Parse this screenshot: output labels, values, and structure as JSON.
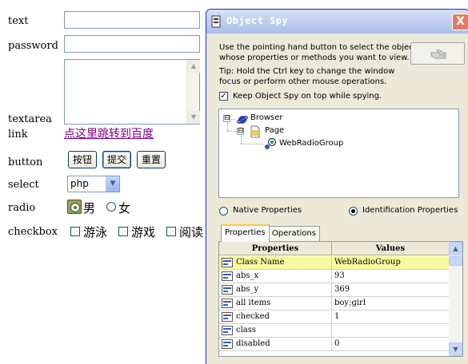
{
  "form": {
    "labels": {
      "text": "text",
      "password": "password",
      "textarea": "textarea",
      "link": "link",
      "button": "button",
      "select": "select",
      "radio": "radio",
      "checkbox": "checkbox"
    },
    "link_text": "点这里跳转到百度",
    "buttons": [
      "按钮",
      "提交",
      "重置"
    ],
    "select_value": "php",
    "radios": [
      {
        "label": "男",
        "checked": true
      },
      {
        "label": "女",
        "checked": false
      }
    ],
    "checkboxes": [
      {
        "label": "游泳",
        "checked": false
      },
      {
        "label": "游戏",
        "checked": false
      },
      {
        "label": "阅读",
        "checked": false
      }
    ]
  },
  "spy": {
    "title": "Object Spy",
    "close_glyph": "X",
    "description": [
      "Use the pointing hand button to select the object",
      "whose properties or methods you want to view."
    ],
    "tip": [
      "Tip: Hold the Ctrl key to change the window",
      "focus or perform other mouse operations."
    ],
    "keep_on_top": {
      "label": "Keep Object Spy on top while spying.",
      "checked": true
    },
    "tree": [
      {
        "label": "Browser",
        "icon": "browser-icon",
        "expander": "⊟"
      },
      {
        "label": "Page",
        "icon": "page-icon",
        "expander": "⊟"
      },
      {
        "label": "WebRadioGroup",
        "icon": "radio-group-icon"
      }
    ],
    "view_options": [
      {
        "label": "Native Properties",
        "selected": false
      },
      {
        "label": "Identification Properties",
        "selected": true
      }
    ],
    "tabs": [
      {
        "label": "Properties",
        "active": true
      },
      {
        "label": "Operations",
        "active": false
      }
    ],
    "columns": [
      "Properties",
      "Values"
    ],
    "rows": [
      {
        "key": "Class Name",
        "value": "WebRadioGroup",
        "selected": true
      },
      {
        "key": "abs_x",
        "value": "93"
      },
      {
        "key": "abs_y",
        "value": "369"
      },
      {
        "key": "all items",
        "value": "boy;girl"
      },
      {
        "key": "checked",
        "value": "1"
      },
      {
        "key": "class",
        "value": ""
      },
      {
        "key": "disabled",
        "value": "0"
      }
    ]
  }
}
